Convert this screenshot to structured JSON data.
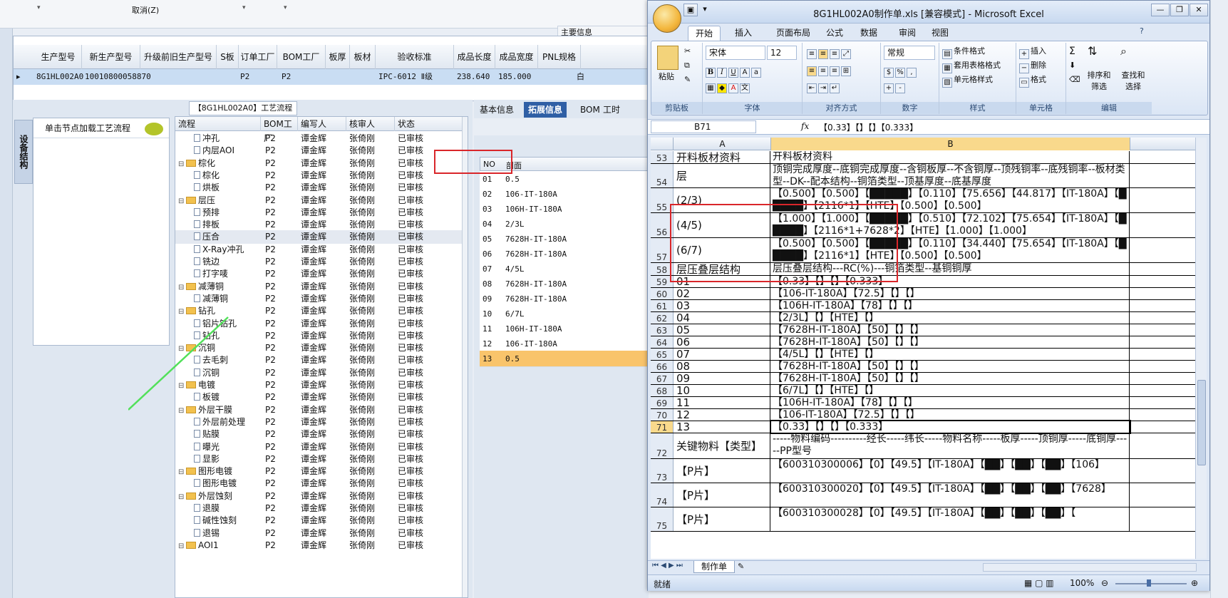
{
  "top": {
    "cancel_label": "取消(Z)",
    "main_info_label": "主要信息"
  },
  "product_grid": {
    "headers": [
      "生产型号",
      "新生产型号",
      "升级前旧生产型号",
      "S板",
      "订单工厂",
      "BOM工厂",
      "板厚",
      "板材",
      "验收标准",
      "成品长度",
      "成品宽度",
      "PNL规格"
    ],
    "row": {
      "model": "8G1HL002A0",
      "new_model": "10010800058870",
      "order_factory": "P2",
      "bom_factory": "P2",
      "standard": "IPC-6012 Ⅱ级",
      "length": "238.640",
      "width": "185.000",
      "pnl": "白"
    }
  },
  "process": {
    "title": "【8G1HL002A0】工艺流程",
    "side_tab": "设备结构",
    "load_label": "单击节点加载工艺流程",
    "headers": [
      "流程",
      "BOM工厂",
      "编写人",
      "核审人",
      "状态"
    ],
    "rows": [
      {
        "name": "冲孔",
        "level": 2,
        "type": "doc",
        "bom": "P2",
        "writer": "谭金辉",
        "reviewer": "张倚刚",
        "status": "已审核"
      },
      {
        "name": "内层AOI",
        "level": 2,
        "type": "doc",
        "bom": "P2",
        "writer": "谭金辉",
        "reviewer": "张倚刚",
        "status": "已审核"
      },
      {
        "name": "棕化",
        "level": 1,
        "type": "folder",
        "bom": "P2",
        "writer": "谭金辉",
        "reviewer": "张倚刚",
        "status": "已审核"
      },
      {
        "name": "棕化",
        "level": 2,
        "type": "doc",
        "bom": "P2",
        "writer": "谭金辉",
        "reviewer": "张倚刚",
        "status": "已审核"
      },
      {
        "name": "烘板",
        "level": 2,
        "type": "doc",
        "bom": "P2",
        "writer": "谭金辉",
        "reviewer": "张倚刚",
        "status": "已审核"
      },
      {
        "name": "层压",
        "level": 1,
        "type": "folder",
        "bom": "P2",
        "writer": "谭金辉",
        "reviewer": "张倚刚",
        "status": "已审核"
      },
      {
        "name": "预排",
        "level": 2,
        "type": "doc",
        "bom": "P2",
        "writer": "谭金辉",
        "reviewer": "张倚刚",
        "status": "已审核"
      },
      {
        "name": "排板",
        "level": 2,
        "type": "doc",
        "bom": "P2",
        "writer": "谭金辉",
        "reviewer": "张倚刚",
        "status": "已审核"
      },
      {
        "name": "压合",
        "level": 2,
        "type": "doc",
        "bom": "P2",
        "writer": "谭金辉",
        "reviewer": "张倚刚",
        "status": "已审核",
        "selected": true
      },
      {
        "name": "X-Ray冲孔",
        "level": 2,
        "type": "doc",
        "bom": "P2",
        "writer": "谭金辉",
        "reviewer": "张倚刚",
        "status": "已审核"
      },
      {
        "name": "铣边",
        "level": 2,
        "type": "doc",
        "bom": "P2",
        "writer": "谭金辉",
        "reviewer": "张倚刚",
        "status": "已审核"
      },
      {
        "name": "打字唛",
        "level": 2,
        "type": "doc",
        "bom": "P2",
        "writer": "谭金辉",
        "reviewer": "张倚刚",
        "status": "已审核"
      },
      {
        "name": "减薄铜",
        "level": 1,
        "type": "folder",
        "bom": "P2",
        "writer": "谭金辉",
        "reviewer": "张倚刚",
        "status": "已审核"
      },
      {
        "name": "减薄铜",
        "level": 2,
        "type": "doc",
        "bom": "P2",
        "writer": "谭金辉",
        "reviewer": "张倚刚",
        "status": "已审核"
      },
      {
        "name": "钻孔",
        "level": 1,
        "type": "folder",
        "bom": "P2",
        "writer": "谭金辉",
        "reviewer": "张倚刚",
        "status": "已审核"
      },
      {
        "name": "铝片钻孔",
        "level": 2,
        "type": "doc",
        "bom": "P2",
        "writer": "谭金辉",
        "reviewer": "张倚刚",
        "status": "已审核"
      },
      {
        "name": "钻孔",
        "level": 2,
        "type": "doc",
        "bom": "P2",
        "writer": "谭金辉",
        "reviewer": "张倚刚",
        "status": "已审核"
      },
      {
        "name": "沉铜",
        "level": 1,
        "type": "folder",
        "bom": "P2",
        "writer": "谭金辉",
        "reviewer": "张倚刚",
        "status": "已审核"
      },
      {
        "name": "去毛刺",
        "level": 2,
        "type": "doc",
        "bom": "P2",
        "writer": "谭金辉",
        "reviewer": "张倚刚",
        "status": "已审核"
      },
      {
        "name": "沉铜",
        "level": 2,
        "type": "doc",
        "bom": "P2",
        "writer": "谭金辉",
        "reviewer": "张倚刚",
        "status": "已审核"
      },
      {
        "name": "电镀",
        "level": 1,
        "type": "folder",
        "bom": "P2",
        "writer": "谭金辉",
        "reviewer": "张倚刚",
        "status": "已审核"
      },
      {
        "name": "板镀",
        "level": 2,
        "type": "doc",
        "bom": "P2",
        "writer": "谭金辉",
        "reviewer": "张倚刚",
        "status": "已审核"
      },
      {
        "name": "外层干膜",
        "level": 1,
        "type": "folder",
        "bom": "P2",
        "writer": "谭金辉",
        "reviewer": "张倚刚",
        "status": "已审核"
      },
      {
        "name": "外层前处理",
        "level": 2,
        "type": "doc",
        "bom": "P2",
        "writer": "谭金辉",
        "reviewer": "张倚刚",
        "status": "已审核"
      },
      {
        "name": "贴膜",
        "level": 2,
        "type": "doc",
        "bom": "P2",
        "writer": "谭金辉",
        "reviewer": "张倚刚",
        "status": "已审核"
      },
      {
        "name": "曝光",
        "level": 2,
        "type": "doc",
        "bom": "P2",
        "writer": "谭金辉",
        "reviewer": "张倚刚",
        "status": "已审核"
      },
      {
        "name": "显影",
        "level": 2,
        "type": "doc",
        "bom": "P2",
        "writer": "谭金辉",
        "reviewer": "张倚刚",
        "status": "已审核"
      },
      {
        "name": "图形电镀",
        "level": 1,
        "type": "folder",
        "bom": "P2",
        "writer": "谭金辉",
        "reviewer": "张倚刚",
        "status": "已审核"
      },
      {
        "name": "图形电镀",
        "level": 2,
        "type": "doc",
        "bom": "P2",
        "writer": "谭金辉",
        "reviewer": "张倚刚",
        "status": "已审核"
      },
      {
        "name": "外层蚀刻",
        "level": 1,
        "type": "folder",
        "bom": "P2",
        "writer": "谭金辉",
        "reviewer": "张倚刚",
        "status": "已审核"
      },
      {
        "name": "退膜",
        "level": 2,
        "type": "doc",
        "bom": "P2",
        "writer": "谭金辉",
        "reviewer": "张倚刚",
        "status": "已审核"
      },
      {
        "name": "碱性蚀刻",
        "level": 2,
        "type": "doc",
        "bom": "P2",
        "writer": "谭金辉",
        "reviewer": "张倚刚",
        "status": "已审核"
      },
      {
        "name": "退锡",
        "level": 2,
        "type": "doc",
        "bom": "P2",
        "writer": "谭金辉",
        "reviewer": "张倚刚",
        "status": "已审核"
      },
      {
        "name": "AOI1",
        "level": 1,
        "type": "folder",
        "bom": "P2",
        "writer": "谭金辉",
        "reviewer": "张倚刚",
        "status": "已审核"
      }
    ]
  },
  "mid": {
    "tabs": [
      "基本信息",
      "拓展信息",
      "BOM",
      "工时"
    ],
    "active_tab": 1,
    "headers": [
      "NO",
      "剖面"
    ],
    "rows": [
      {
        "no": "01",
        "profile": "0.5"
      },
      {
        "no": "02",
        "profile": "106-IT-180A"
      },
      {
        "no": "03",
        "profile": "106H-IT-180A"
      },
      {
        "no": "04",
        "profile": "2/3L"
      },
      {
        "no": "05",
        "profile": "7628H-IT-180A"
      },
      {
        "no": "06",
        "profile": "7628H-IT-180A"
      },
      {
        "no": "07",
        "profile": "4/5L"
      },
      {
        "no": "08",
        "profile": "7628H-IT-180A"
      },
      {
        "no": "09",
        "profile": "7628H-IT-180A"
      },
      {
        "no": "10",
        "profile": "6/7L"
      },
      {
        "no": "11",
        "profile": "106H-IT-180A"
      },
      {
        "no": "12",
        "profile": "106-IT-180A"
      },
      {
        "no": "13",
        "profile": "0.5",
        "selected": true
      }
    ]
  },
  "excel": {
    "title": "8G1HL002A0制作单.xls  [兼容模式] - Microsoft Excel",
    "tabs": [
      "开始",
      "插入",
      "页面布局",
      "公式",
      "数据",
      "审阅",
      "视图"
    ],
    "active_tab": 0,
    "ribbon": {
      "paste": "粘贴",
      "font_name": "宋体",
      "font_size": "12",
      "number_format": "常规",
      "cond_format": "条件格式",
      "table_format": "套用表格格式",
      "cell_style": "单元格样式",
      "insert": "插入",
      "delete": "删除",
      "format": "格式",
      "sort": "排序和\n筛选",
      "find": "查找和\n选择",
      "groups": [
        "剪贴板",
        "字体",
        "对齐方式",
        "数字",
        "样式",
        "单元格",
        "编辑"
      ]
    },
    "name_box": "B71",
    "formula": "【0.33】【】【】【0.333】",
    "columns": [
      "A",
      "B"
    ],
    "rows": [
      {
        "n": "53",
        "a": "开料板材资料",
        "b": "开料板材资料",
        "h": 18
      },
      {
        "n": "54",
        "a": "层",
        "b": "顶铜完成厚度--底铜完成厚度--含铜板厚--不含铜厚--顶残铜率--底残铜率--板材类型--DK--配本结构--铜箔类型--顶基厚度--底基厚度",
        "h": 34
      },
      {
        "n": "55",
        "a": "(2/3)",
        "b": "【0.500】【0.500】【█████】【0.110】【75.656】【44.817】【IT-180A】【█████】【2116*1】【HTE】【0.500】【0.500】",
        "h": 35
      },
      {
        "n": "56",
        "a": "(4/5)",
        "b": "【1.000】【1.000】【█████】【0.510】【72.102】【75.654】【IT-180A】【█████】【2116*1+7628*2】【HTE】【1.000】【1.000】",
        "h": 35
      },
      {
        "n": "57",
        "a": "(6/7)",
        "b": "【0.500】【0.500】【█████】【0.110】【34.440】【75.654】【IT-180A】【█████】【2116*1】【HTE】【0.500】【0.500】",
        "h": 35
      },
      {
        "n": "58",
        "a": "层压叠层结构",
        "b": "层压叠层结构---RC(%)---铜箔类型--基铜铜厚",
        "h": 18
      },
      {
        "n": "59",
        "a": "01",
        "b": "【0.33】【】【】【0.333】",
        "h": 17
      },
      {
        "n": "60",
        "a": "02",
        "b": "【106-IT-180A】【72.5】【】【】",
        "h": 17
      },
      {
        "n": "61",
        "a": "03",
        "b": "【106H-IT-180A】【78】【】【】",
        "h": 17
      },
      {
        "n": "62",
        "a": "04",
        "b": "【2/3L】【】【HTE】【】",
        "h": 17
      },
      {
        "n": "63",
        "a": "05",
        "b": "【7628H-IT-180A】【50】【】【】",
        "h": 17
      },
      {
        "n": "64",
        "a": "06",
        "b": "【7628H-IT-180A】【50】【】【】",
        "h": 17
      },
      {
        "n": "65",
        "a": "07",
        "b": "【4/5L】【】【HTE】【】",
        "h": 17
      },
      {
        "n": "66",
        "a": "08",
        "b": "【7628H-IT-180A】【50】【】【】",
        "h": 17
      },
      {
        "n": "67",
        "a": "09",
        "b": "【7628H-IT-180A】【50】【】【】",
        "h": 17
      },
      {
        "n": "68",
        "a": "10",
        "b": "【6/7L】【】【HTE】【】",
        "h": 17
      },
      {
        "n": "69",
        "a": "11",
        "b": "【106H-IT-180A】【78】【】【】",
        "h": 17
      },
      {
        "n": "70",
        "a": "12",
        "b": "【106-IT-180A】【72.5】【】【】",
        "h": 17
      },
      {
        "n": "71",
        "a": "13",
        "b": "【0.33】【】【】【0.333】",
        "h": 17,
        "active": true
      },
      {
        "n": "72",
        "a": "关键物料【类型】",
        "b": "-----物料编码----------经长-----纬长-----物料名称-----板厚-----顶铜厚-----底铜厚-----PP型号",
        "h": 36
      },
      {
        "n": "73",
        "a": "【P片】",
        "b": "【600310300006】【0】【49.5】【IT-180A】【██】【██】【██】【106】",
        "h": 34
      },
      {
        "n": "74",
        "a": "【P片】",
        "b": "【600310300020】【0】【49.5】【IT-180A】【██】【██】【██】【7628】",
        "h": 34
      },
      {
        "n": "75",
        "a": "【P片】",
        "b": "【600310300028】【0】【49.5】【IT-180A】【██】【██】【██】【",
        "h": 34
      }
    ],
    "sheet_tab": "制作单",
    "status": "就绪",
    "zoom": "100%"
  }
}
